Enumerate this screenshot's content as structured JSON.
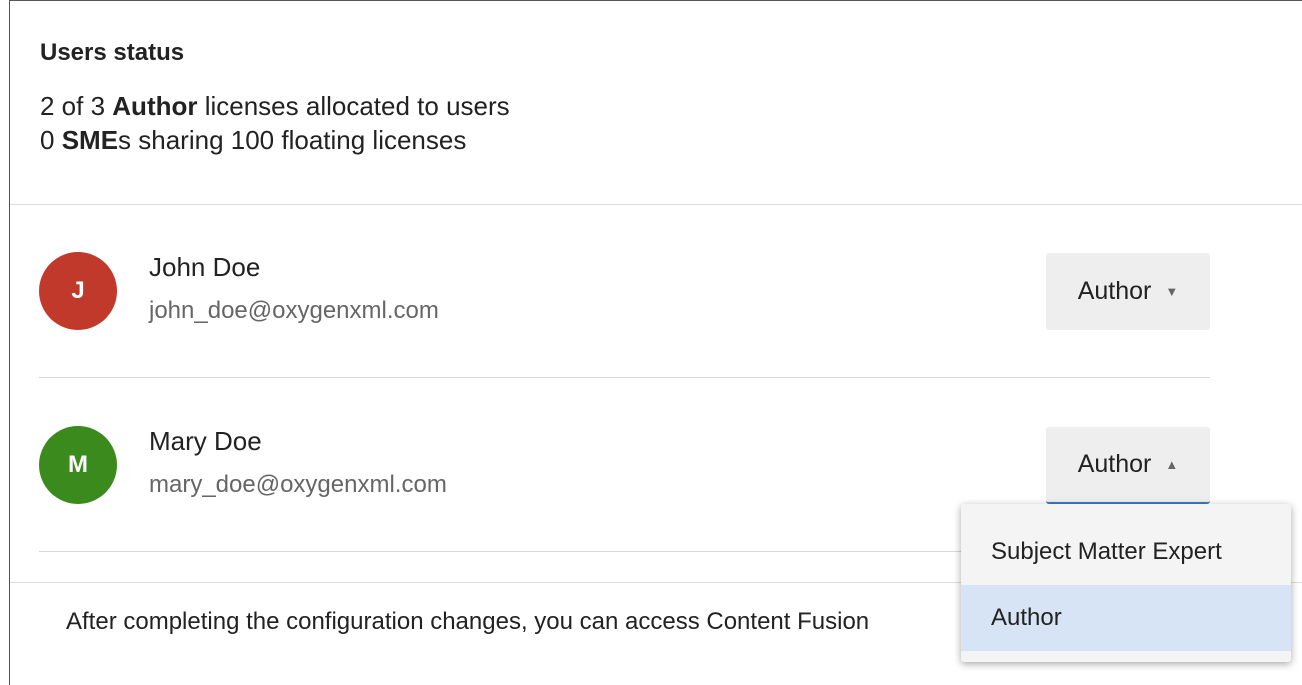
{
  "status": {
    "title": "Users status",
    "line1": {
      "prefix": "2 of 3 ",
      "bold": "Author",
      "suffix": " licenses allocated to users"
    },
    "line2": {
      "prefix": "0 ",
      "bold": "SME",
      "suffix": "s sharing 100 floating licenses"
    }
  },
  "users": [
    {
      "initial": "J",
      "name": "John Doe",
      "email": "john_doe@oxygenxml.com",
      "role": "Author",
      "avatar_color": "#c0392b"
    },
    {
      "initial": "M",
      "name": "Mary Doe",
      "email": "mary_doe@oxygenxml.com",
      "role": "Author",
      "avatar_color": "#3a8a1e"
    }
  ],
  "role_menu": {
    "options": [
      "Subject Matter Expert",
      "Author"
    ],
    "selected": "Author"
  },
  "footer": {
    "text": "After completing the configuration changes, you can access Content Fusion"
  },
  "colors": {
    "accent": "#3b7bc8",
    "selected_option_bg": "#d6e4f5"
  }
}
